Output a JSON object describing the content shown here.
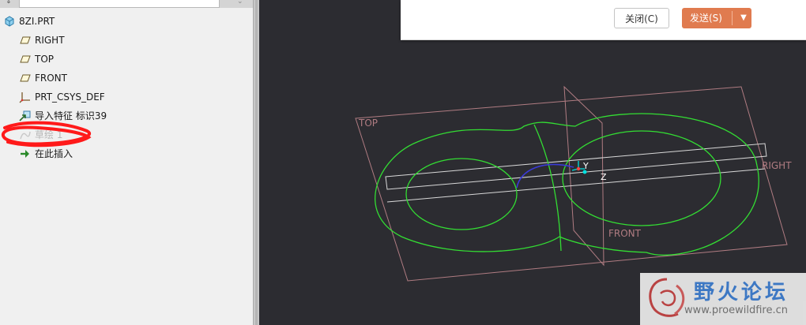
{
  "model_tree": {
    "root": {
      "label": "8ZI.PRT",
      "icon": "part-icon"
    },
    "items": [
      {
        "label": "RIGHT",
        "icon": "datum-plane-icon"
      },
      {
        "label": "TOP",
        "icon": "datum-plane-icon"
      },
      {
        "label": "FRONT",
        "icon": "datum-plane-icon"
      },
      {
        "label": "PRT_CSYS_DEF",
        "icon": "csys-icon"
      },
      {
        "label": "导入特征 标识39",
        "icon": "import-feature-icon"
      },
      {
        "label": "草绘 1",
        "icon": "sketch-icon",
        "state": "suppressed"
      },
      {
        "label": "在此插入",
        "icon": "insert-here-arrow-icon"
      }
    ]
  },
  "viewport": {
    "datum_labels": {
      "top": "TOP",
      "right": "RIGHT",
      "front": "FRONT"
    },
    "csys_labels": {
      "y": "Y",
      "z": "Z"
    },
    "colors": {
      "background": "#2c2c31",
      "datum": "#b07c82",
      "sketch": "#33dd33",
      "selected_arc": "#3a3ad6",
      "csys": "#00e0e0",
      "annotation_scribble": "#ff1a1a"
    }
  },
  "dialog": {
    "close_label": "关闭(C)",
    "send_label": "发送(S)",
    "send_dropdown_icon": "chevron-down-icon",
    "send_color": "#e07b4f"
  },
  "watermark": {
    "title": "野火论坛",
    "url": "www.proewildfire.cn",
    "title_color": "#3d78c4"
  }
}
